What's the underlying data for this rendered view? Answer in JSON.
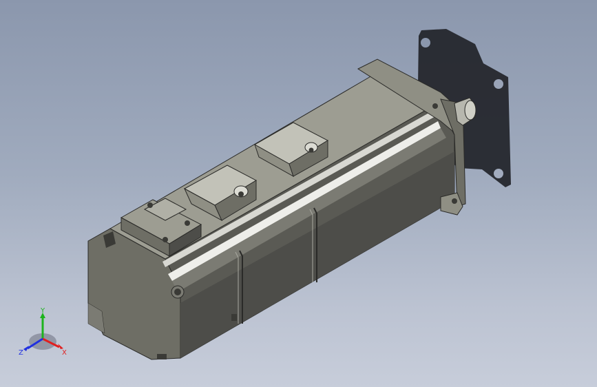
{
  "viewport": {
    "background_top": "#8b97ad",
    "background_bottom": "#c7cdda",
    "model_colors": {
      "body_light": "#8f8f84",
      "body_mid": "#6e6e65",
      "body_dark": "#4d4d49",
      "body_top": "#9d9d92",
      "highlight": "#eeeeea",
      "shadow": "#25272d"
    }
  },
  "triad": {
    "y_label": "Y",
    "x_label": "X",
    "z_label": "Z",
    "y_color": "#1db31d",
    "x_color": "#e02020",
    "z_color": "#2030e0"
  }
}
